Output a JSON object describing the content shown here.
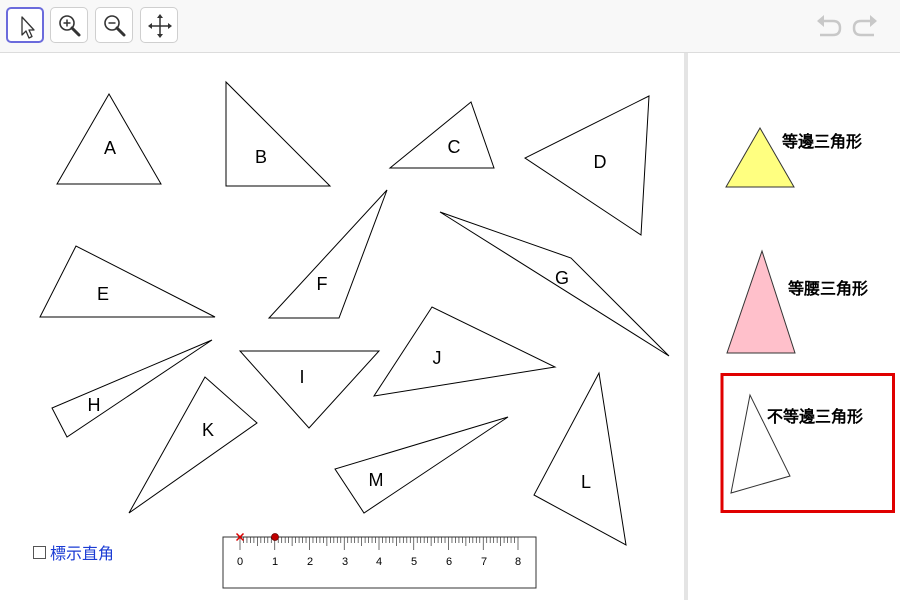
{
  "toolbar": {
    "tools": [
      {
        "name": "move-tool",
        "icon": "cursor-arrow-icon",
        "active": true
      },
      {
        "name": "zoom-in-tool",
        "icon": "zoom-in-icon",
        "active": false
      },
      {
        "name": "zoom-out-tool",
        "icon": "zoom-out-icon",
        "active": false
      },
      {
        "name": "move-view-tool",
        "icon": "move-arrows-icon",
        "active": false
      }
    ],
    "history": [
      {
        "name": "undo",
        "icon": "undo-icon",
        "enabled": false
      },
      {
        "name": "redo",
        "icon": "redo-icon",
        "enabled": false
      }
    ]
  },
  "triangles": {
    "A": "A",
    "B": "B",
    "C": "C",
    "D": "D",
    "E": "E",
    "F": "F",
    "G": "G",
    "H": "H",
    "I": "I",
    "J": "J",
    "K": "K",
    "L": "L",
    "M": "M"
  },
  "checkbox": {
    "label": "標示直角",
    "checked": false
  },
  "ruler": {
    "ticks": [
      "0",
      "1",
      "2",
      "3",
      "4",
      "5",
      "6",
      "7",
      "8"
    ]
  },
  "categories": {
    "equilateral": {
      "label": "等邊三角形",
      "color": "#ffff80"
    },
    "isosceles": {
      "label": "等腰三角形",
      "color": "#ffc0cb"
    },
    "scalene": {
      "label": "不等邊三角形",
      "frame_color": "#e00000"
    }
  }
}
